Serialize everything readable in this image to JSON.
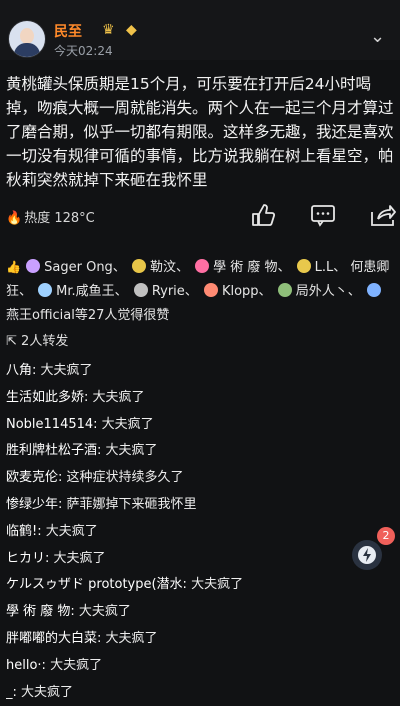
{
  "header": {
    "user_name": "民至",
    "time": "今天02:24",
    "more": "⌄",
    "badges": [
      "crown-icon",
      "gem-icon"
    ]
  },
  "post": {
    "text": "黄桃罐头保质期是15个月，可乐要在打开后24小时喝掉，吻痕大概一周就能消失。两个人在一起三个月才算过了磨合期，似乎一切都有期限。这样多无趣，我还是喜欢一切没有规律可循的事情，比方说我躺在树上看星空，帕秋莉突然就掉下来砸在我怀里"
  },
  "actions": {
    "heat_label": "热度 128°C",
    "icons": [
      "like-icon",
      "comment-icon",
      "share-icon"
    ]
  },
  "likes": {
    "users": [
      "Sager Ong、",
      "勒汶、",
      "學 術 廢 物、",
      "L.L、",
      "何患卿狂、",
      "Mr.咸鱼王、",
      "Ryrie、",
      "Klopp、",
      "局外人丶、",
      "燕王official"
    ],
    "suffix": "等27人觉得很赞",
    "avatar_colors": [
      "#c9a0ff",
      "#e7c548",
      "#ff6fa3",
      "#e8c84c",
      "#8f8fff",
      "#9fd1ff",
      "#c0c0c0",
      "#ff8a73",
      "#8fbf7a",
      "#7fb2ff"
    ]
  },
  "forward": {
    "label": "2人转发"
  },
  "comments": [
    {
      "user": "八角:",
      "text": " 大夫疯了"
    },
    {
      "user": "生活如此多娇:",
      "text": " 大夫疯了"
    },
    {
      "user": "Noble114514:",
      "text": " 大夫疯了"
    },
    {
      "user": "胜利牌杜松子酒:",
      "text": " 大夫疯了"
    },
    {
      "user": "欧麦克伦:",
      "text": " 这种症状持续多久了"
    },
    {
      "user": "惨绿少年:",
      "text": " 萨菲娜掉下来砸我怀里"
    },
    {
      "user": "临鹤!:",
      "text": " 大夫疯了"
    },
    {
      "user": "ヒカリ:",
      "text": " 大夫疯了"
    },
    {
      "user": "ケルスゥザド prototype(潜水:",
      "text": " 大夫疯了"
    },
    {
      "user": "學 術 廢 物:",
      "text": " 大夫疯了"
    },
    {
      "user": "胖嘟嘟的大白菜:",
      "text": " 大夫疯了"
    },
    {
      "user": "hello·:",
      "text": " 大夫疯了"
    },
    {
      "user": "_:",
      "text": " 大夫疯了"
    }
  ],
  "fab": {
    "badge": "2"
  }
}
